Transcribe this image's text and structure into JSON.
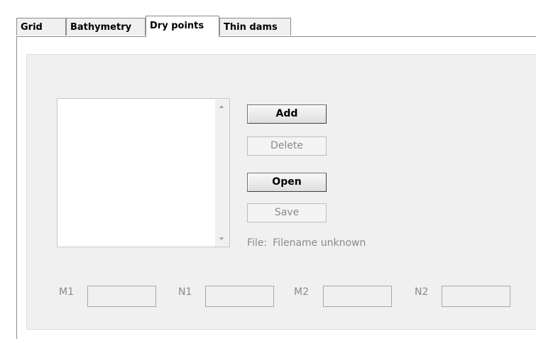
{
  "tabs": [
    {
      "label": "Grid",
      "active": false
    },
    {
      "label": "Bathymetry",
      "active": false
    },
    {
      "label": "Dry points",
      "active": true
    },
    {
      "label": "Thin dams",
      "active": false
    }
  ],
  "dry_points": {
    "list_items": [],
    "buttons": {
      "add": {
        "label": "Add",
        "enabled": true
      },
      "delete": {
        "label": "Delete",
        "enabled": false
      },
      "open": {
        "label": "Open",
        "enabled": true
      },
      "save": {
        "label": "Save",
        "enabled": false
      }
    },
    "file_label": "File:",
    "file_name": "Filename unknown",
    "coordinates": {
      "m1": {
        "label": "M1",
        "value": ""
      },
      "n1": {
        "label": "N1",
        "value": ""
      },
      "m2": {
        "label": "M2",
        "value": ""
      },
      "n2": {
        "label": "N2",
        "value": ""
      }
    }
  },
  "icons": [
    "scroll-up-arrow-icon",
    "scroll-down-arrow-icon"
  ]
}
